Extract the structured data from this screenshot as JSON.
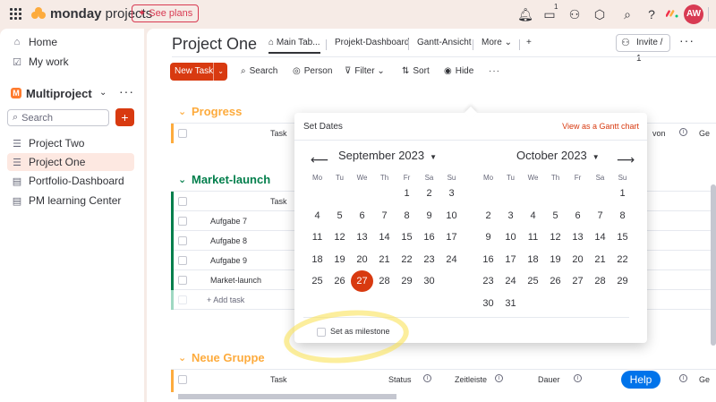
{
  "app": {
    "logo_bold": "monday",
    "logo_rest": " projects",
    "see_plans": "See plans",
    "notification_count": "1",
    "avatar": "AW",
    "brand_colors": [
      "#f0314a",
      "#fdab3d",
      "#00c875"
    ]
  },
  "sidebar": {
    "home": "Home",
    "my_work": "My work",
    "workspace_initial": "M",
    "workspace": "Multiproject",
    "search_placeholder": "Search",
    "add": "+",
    "items": [
      "Project Two",
      "Project One",
      "Portfolio-Dashboard",
      "PM learning Center"
    ]
  },
  "board": {
    "title": "Project One",
    "tabs": [
      "Main Tab...",
      "Projekt-Dashboard",
      "Gantt-Ansicht",
      "More",
      "+"
    ],
    "invite": "Invite / 1",
    "toolbar": {
      "new_task": "New Task",
      "search": "Search",
      "person": "Person",
      "filter": "Filter",
      "sort": "Sort",
      "hide": "Hide"
    },
    "accent": "#d83a10"
  },
  "groups": [
    {
      "name": "Progress",
      "color": "#fdab3d",
      "col_task": "Task",
      "extra_col": "von",
      "extra_col2": "Ge",
      "rows": []
    },
    {
      "name": "Market-launch",
      "color": "#037f4c",
      "col_task": "Task",
      "rows": [
        "Aufgabe 7",
        "Aufgabe 8",
        "Aufgabe 9",
        "Market-launch"
      ],
      "add_task": "+ Add task"
    },
    {
      "name": "Neue Gruppe",
      "color": "#fdab3d",
      "col_task": "Task",
      "cols": [
        "Status",
        "Zeitleiste",
        "Dauer",
        "Ge"
      ]
    }
  ],
  "datepicker": {
    "title": "Set Dates",
    "gantt_link": "View as a Gantt chart",
    "weekdays": [
      "Mo",
      "Tu",
      "We",
      "Th",
      "Fr",
      "Sa",
      "Su"
    ],
    "left_month": "September 2023",
    "right_month": "October 2023",
    "selected_day": "27",
    "milestone_label": "Set as milestone"
  },
  "help": "Help"
}
